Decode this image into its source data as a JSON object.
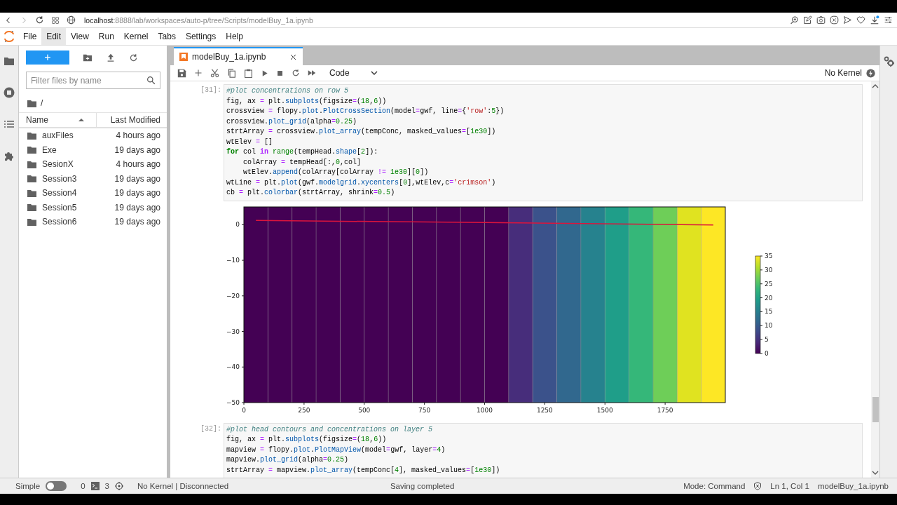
{
  "browser": {
    "url_host": "localhost",
    "url_rest": ":8888/lab/workspaces/auto-p/tree/Scripts/modelBuy_1a.ipynb"
  },
  "menu": [
    {
      "label": "File",
      "selected": false
    },
    {
      "label": "Edit",
      "selected": true
    },
    {
      "label": "View",
      "selected": false
    },
    {
      "label": "Run",
      "selected": false
    },
    {
      "label": "Kernel",
      "selected": false
    },
    {
      "label": "Tabs",
      "selected": false
    },
    {
      "label": "Settings",
      "selected": false
    },
    {
      "label": "Help",
      "selected": false
    }
  ],
  "file_browser": {
    "new_button": "+",
    "filter_placeholder": "Filter files by name",
    "path": "/",
    "columns": [
      "Name",
      "Last Modified"
    ],
    "rows": [
      {
        "name": "auxFiles",
        "modified": "4 hours ago"
      },
      {
        "name": "Exe",
        "modified": "19 days ago"
      },
      {
        "name": "SesionX",
        "modified": "4 hours ago"
      },
      {
        "name": "Session3",
        "modified": "19 days ago"
      },
      {
        "name": "Session4",
        "modified": "19 days ago"
      },
      {
        "name": "Session5",
        "modified": "19 days ago"
      },
      {
        "name": "Session6",
        "modified": "19 days ago"
      }
    ]
  },
  "tab": {
    "title": "modelBuy_1a.ipynb"
  },
  "toolbar": {
    "cell_type": "Code",
    "kernel": "No Kernel"
  },
  "cells": [
    {
      "prompt": "[31]:",
      "lines": [
        [
          {
            "kind": "comment",
            "text": "#plot concentrations on row 5"
          }
        ],
        [
          {
            "kind": "plain",
            "text": "fig, ax "
          },
          {
            "kind": "operator",
            "text": "="
          },
          {
            "kind": "plain",
            "text": " plt."
          },
          {
            "kind": "attribute",
            "text": "subplots"
          },
          {
            "kind": "plain",
            "text": "(figsize"
          },
          {
            "kind": "operator",
            "text": "="
          },
          {
            "kind": "plain",
            "text": "("
          },
          {
            "kind": "number",
            "text": "18"
          },
          {
            "kind": "plain",
            "text": ","
          },
          {
            "kind": "number",
            "text": "6"
          },
          {
            "kind": "plain",
            "text": "))"
          }
        ],
        [
          {
            "kind": "plain",
            "text": "crossview "
          },
          {
            "kind": "operator",
            "text": "="
          },
          {
            "kind": "plain",
            "text": " flopy."
          },
          {
            "kind": "attribute",
            "text": "plot"
          },
          {
            "kind": "plain",
            "text": "."
          },
          {
            "kind": "attribute",
            "text": "PlotCrossSection"
          },
          {
            "kind": "plain",
            "text": "(model"
          },
          {
            "kind": "operator",
            "text": "="
          },
          {
            "kind": "plain",
            "text": "gwf, line"
          },
          {
            "kind": "operator",
            "text": "="
          },
          {
            "kind": "plain",
            "text": "{"
          },
          {
            "kind": "string",
            "text": "'row'"
          },
          {
            "kind": "plain",
            "text": ":"
          },
          {
            "kind": "number",
            "text": "5"
          },
          {
            "kind": "plain",
            "text": "})"
          }
        ],
        [
          {
            "kind": "plain",
            "text": "crossview."
          },
          {
            "kind": "attribute",
            "text": "plot_grid"
          },
          {
            "kind": "plain",
            "text": "(alpha"
          },
          {
            "kind": "operator",
            "text": "="
          },
          {
            "kind": "number",
            "text": "0.25"
          },
          {
            "kind": "plain",
            "text": ")"
          }
        ],
        [
          {
            "kind": "plain",
            "text": "strtArray "
          },
          {
            "kind": "operator",
            "text": "="
          },
          {
            "kind": "plain",
            "text": " crossview."
          },
          {
            "kind": "attribute",
            "text": "plot_array"
          },
          {
            "kind": "plain",
            "text": "(tempConc, masked_values"
          },
          {
            "kind": "operator",
            "text": "="
          },
          {
            "kind": "plain",
            "text": "["
          },
          {
            "kind": "number",
            "text": "1e30"
          },
          {
            "kind": "plain",
            "text": "])"
          }
        ],
        [
          {
            "kind": "plain",
            "text": "wtElev "
          },
          {
            "kind": "operator",
            "text": "="
          },
          {
            "kind": "plain",
            "text": " []"
          }
        ],
        [
          {
            "kind": "keyword",
            "text": "for"
          },
          {
            "kind": "plain",
            "text": " col "
          },
          {
            "kind": "operator_word",
            "text": "in"
          },
          {
            "kind": "builtin",
            "text": " range"
          },
          {
            "kind": "plain",
            "text": "(tempHead."
          },
          {
            "kind": "attribute",
            "text": "shape"
          },
          {
            "kind": "plain",
            "text": "["
          },
          {
            "kind": "number",
            "text": "2"
          },
          {
            "kind": "plain",
            "text": "]):"
          }
        ],
        [
          {
            "kind": "plain",
            "text": "    colArray "
          },
          {
            "kind": "operator",
            "text": "="
          },
          {
            "kind": "plain",
            "text": " tempHead[:,"
          },
          {
            "kind": "number",
            "text": "0"
          },
          {
            "kind": "plain",
            "text": ",col]"
          }
        ],
        [
          {
            "kind": "plain",
            "text": "    wtElev."
          },
          {
            "kind": "attribute",
            "text": "append"
          },
          {
            "kind": "plain",
            "text": "(colArray[colArray "
          },
          {
            "kind": "operator",
            "text": "!="
          },
          {
            "kind": "number",
            "text": " 1e30"
          },
          {
            "kind": "plain",
            "text": "]["
          },
          {
            "kind": "number",
            "text": "0"
          },
          {
            "kind": "plain",
            "text": "])"
          }
        ],
        [
          {
            "kind": "plain",
            "text": "wtLine "
          },
          {
            "kind": "operator",
            "text": "="
          },
          {
            "kind": "plain",
            "text": " plt."
          },
          {
            "kind": "attribute",
            "text": "plot"
          },
          {
            "kind": "plain",
            "text": "(gwf."
          },
          {
            "kind": "attribute",
            "text": "modelgrid"
          },
          {
            "kind": "plain",
            "text": "."
          },
          {
            "kind": "attribute",
            "text": "xycenters"
          },
          {
            "kind": "plain",
            "text": "["
          },
          {
            "kind": "number",
            "text": "0"
          },
          {
            "kind": "plain",
            "text": "],wtElev,c"
          },
          {
            "kind": "operator",
            "text": "="
          },
          {
            "kind": "string",
            "text": "'crimson'"
          },
          {
            "kind": "plain",
            "text": ")"
          }
        ],
        [
          {
            "kind": "plain",
            "text": "cb "
          },
          {
            "kind": "operator",
            "text": "="
          },
          {
            "kind": "plain",
            "text": " plt."
          },
          {
            "kind": "attribute",
            "text": "colorbar"
          },
          {
            "kind": "plain",
            "text": "(strtArray, shrink"
          },
          {
            "kind": "operator",
            "text": "="
          },
          {
            "kind": "number",
            "text": "0.5"
          },
          {
            "kind": "plain",
            "text": ")"
          }
        ]
      ],
      "figure": {
        "yticks": [
          "0",
          "−10",
          "−20",
          "−30",
          "−40",
          "−50"
        ],
        "xticks": [
          "0",
          "250",
          "500",
          "750",
          "1000",
          "1250",
          "1500",
          "1750"
        ],
        "colorbar_ticks": [
          "35",
          "30",
          "25",
          "20",
          "15",
          "10",
          "5",
          "0"
        ]
      }
    },
    {
      "prompt": "[32]:",
      "lines": [
        [
          {
            "kind": "comment",
            "text": "#plot head contours and concentrations on layer 5"
          }
        ],
        [
          {
            "kind": "plain",
            "text": "fig, ax "
          },
          {
            "kind": "operator",
            "text": "="
          },
          {
            "kind": "plain",
            "text": " plt."
          },
          {
            "kind": "attribute",
            "text": "subplots"
          },
          {
            "kind": "plain",
            "text": "(figsize"
          },
          {
            "kind": "operator",
            "text": "="
          },
          {
            "kind": "plain",
            "text": "("
          },
          {
            "kind": "number",
            "text": "18"
          },
          {
            "kind": "plain",
            "text": ","
          },
          {
            "kind": "number",
            "text": "6"
          },
          {
            "kind": "plain",
            "text": "))"
          }
        ],
        [
          {
            "kind": "plain",
            "text": "mapview "
          },
          {
            "kind": "operator",
            "text": "="
          },
          {
            "kind": "plain",
            "text": " flopy."
          },
          {
            "kind": "attribute",
            "text": "plot"
          },
          {
            "kind": "plain",
            "text": "."
          },
          {
            "kind": "attribute",
            "text": "PlotMapView"
          },
          {
            "kind": "plain",
            "text": "(model"
          },
          {
            "kind": "operator",
            "text": "="
          },
          {
            "kind": "plain",
            "text": "gwf, layer"
          },
          {
            "kind": "operator",
            "text": "="
          },
          {
            "kind": "number",
            "text": "4"
          },
          {
            "kind": "plain",
            "text": ")"
          }
        ],
        [
          {
            "kind": "plain",
            "text": "mapview."
          },
          {
            "kind": "attribute",
            "text": "plot_grid"
          },
          {
            "kind": "plain",
            "text": "(alpha"
          },
          {
            "kind": "operator",
            "text": "="
          },
          {
            "kind": "number",
            "text": "0.25"
          },
          {
            "kind": "plain",
            "text": ")"
          }
        ],
        [
          {
            "kind": "plain",
            "text": "strtArray "
          },
          {
            "kind": "operator",
            "text": "="
          },
          {
            "kind": "plain",
            "text": " mapview."
          },
          {
            "kind": "attribute",
            "text": "plot_array"
          },
          {
            "kind": "plain",
            "text": "(tempConc["
          },
          {
            "kind": "number",
            "text": "4"
          },
          {
            "kind": "plain",
            "text": "], masked_values"
          },
          {
            "kind": "operator",
            "text": "="
          },
          {
            "kind": "plain",
            "text": "["
          },
          {
            "kind": "number",
            "text": "1e30"
          },
          {
            "kind": "plain",
            "text": "])"
          }
        ]
      ]
    }
  ],
  "status_bar": {
    "mode_label": "Simple",
    "simple_on": false,
    "terminals": "0",
    "kernels": "3",
    "kernel_status": "No Kernel | Disconnected",
    "message": "Saving completed",
    "mode": "Mode: Command",
    "cursor": "Ln 1, Col 1",
    "file": "modelBuy_1a.ipynb"
  }
}
